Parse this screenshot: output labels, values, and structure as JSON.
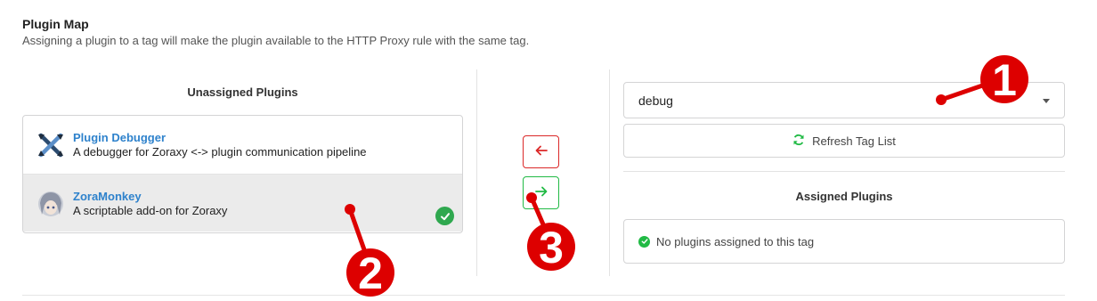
{
  "header": {
    "title": "Plugin Map",
    "subtitle": "Assigning a plugin to a tag will make the plugin available to the HTTP Proxy rule with the same tag."
  },
  "unassigned": {
    "heading": "Unassigned Plugins",
    "items": [
      {
        "name": "Plugin Debugger",
        "description": "A debugger for Zoraxy <-> plugin communication pipeline",
        "icon": "debugger-icon",
        "selected": false
      },
      {
        "name": "ZoraMonkey",
        "description": "A scriptable add-on for Zoraxy",
        "icon": "zoramonkey-avatar-icon",
        "selected": true
      }
    ]
  },
  "controls": {
    "remove_icon": "arrow-left-icon",
    "add_icon": "arrow-right-icon"
  },
  "tag_select": {
    "value": "debug"
  },
  "refresh": {
    "label": "Refresh Tag List",
    "icon": "refresh-icon"
  },
  "assigned": {
    "heading": "Assigned Plugins",
    "empty_message": "No plugins assigned to this tag"
  },
  "annotations": [
    "1",
    "2",
    "3"
  ],
  "colors": {
    "link": "#2e82cc",
    "success": "#21ba45",
    "danger": "#db2828",
    "annotation": "#dd0000"
  }
}
